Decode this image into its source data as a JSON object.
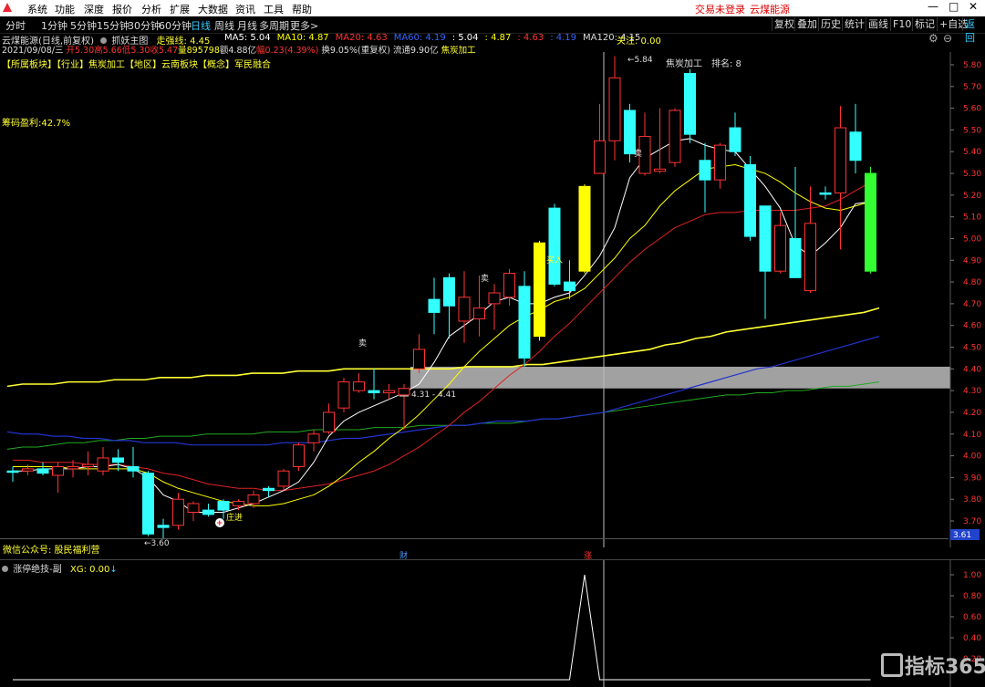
{
  "menubar": {
    "items": [
      "系统",
      "功能",
      "深度",
      "报价",
      "分析",
      "扩展",
      "大数据",
      "资讯",
      "工具",
      "帮助"
    ],
    "login_status": "交易未登录",
    "stock_name": "云煤能源"
  },
  "timeframes": {
    "items": [
      "分时",
      "1分钟",
      "5分钟",
      "15分钟",
      "30分钟",
      "60分钟",
      "日线",
      "周线",
      "月线",
      "多周期",
      "更多>"
    ],
    "active": "日线"
  },
  "right_buttons": [
    "复权",
    "叠加",
    "历史",
    "统计",
    "画线",
    "F10",
    "标记",
    "+自选",
    "返回"
  ],
  "chart_header": {
    "title": "云煤能源(日线,前复权)",
    "indicator_name": "抓妖主图",
    "trend_label": "走强线: 4.45",
    "ma_items": [
      {
        "text": "MA5: 5.04",
        "color": "#ffffff"
      },
      {
        "text": "MA10: 4.87",
        "color": "#ffff00"
      },
      {
        "text": "MA20: 4.63",
        "color": "#ff3333"
      },
      {
        "text": "MA60: 4.19",
        "color": "#3366ff"
      },
      {
        "text": ": 5.04",
        "color": "#ffffff"
      },
      {
        "text": ": 4.87",
        "color": "#ffff00"
      },
      {
        "text": ": 4.63",
        "color": "#ff3333"
      },
      {
        "text": ": 4.19",
        "color": "#3366ff"
      },
      {
        "text": "MA120: 4.15",
        "color": "#dddddd"
      }
    ],
    "watch": "关注: 0.00"
  },
  "info_line": {
    "date": "2021/09/08/三",
    "open": "开5.30",
    "high": "高5.66",
    "low": "低5.30",
    "close": "收5.47",
    "volume": "量895798",
    "amount": "额4.88亿",
    "change": "幅0.23(4.39%)",
    "turnover": "换9.05%(重复权)",
    "float": "流通9.90亿",
    "sector": "焦炭加工"
  },
  "sector_line": "【所属板块】【行业】焦炭加工【地区】云南板块【概念】军民融合",
  "chip_profit": "筹码盈利:42.7%",
  "annotations": {
    "peak": "5.84",
    "sector_tag": "焦炭加工",
    "rank": "排名: 8",
    "sell": "卖",
    "range": "4.31 - 4.41",
    "low": "3.60",
    "dealer": "庄进",
    "buy": "买入"
  },
  "price_axis": [
    "5.80",
    "5.70",
    "5.60",
    "5.50",
    "5.40",
    "5.30",
    "5.20",
    "5.10",
    "5.00",
    "4.90",
    "4.80",
    "4.70",
    "4.60",
    "4.50",
    "4.40",
    "4.30",
    "4.20",
    "4.10",
    "4.00",
    "3.90",
    "3.80",
    "3.70"
  ],
  "price_axis_current": "3.61",
  "bottom_bar": {
    "wechat": "微信公众号: 股民福利营",
    "cai": "财",
    "zhang": "涨"
  },
  "sub_chart": {
    "title": "涨停绝技-副",
    "xg": "XG: 0.00",
    "axis": [
      "1.00",
      "0.80",
      "0.60",
      "0.40",
      "0.20"
    ]
  },
  "watermark": "指标365",
  "colors": {
    "up": "#ff3333",
    "down": "#33ffff",
    "highlight_yellow": "#ffff00",
    "highlight_green": "#33ff33",
    "ma5": "#ffffff",
    "ma10": "#ffff00",
    "ma20": "#dd2222",
    "ma60": "#2233cc",
    "ma120": "#22aa22",
    "trend": "#ffff33"
  },
  "chart_data": {
    "type": "candlestick",
    "candles": [
      {
        "o": 3.93,
        "h": 3.95,
        "l": 3.88,
        "c": 3.93,
        "col": "down"
      },
      {
        "o": 3.93,
        "h": 3.96,
        "l": 3.91,
        "c": 3.94,
        "col": "up"
      },
      {
        "o": 3.94,
        "h": 3.97,
        "l": 3.91,
        "c": 3.92,
        "col": "down"
      },
      {
        "o": 3.91,
        "h": 3.97,
        "l": 3.83,
        "c": 3.95,
        "col": "up"
      },
      {
        "o": 3.95,
        "h": 3.98,
        "l": 3.9,
        "c": 3.94,
        "col": "up"
      },
      {
        "o": 3.95,
        "h": 4.02,
        "l": 3.91,
        "c": 3.96,
        "col": "up"
      },
      {
        "o": 3.93,
        "h": 4.04,
        "l": 3.91,
        "c": 3.99,
        "col": "up"
      },
      {
        "o": 3.99,
        "h": 4.03,
        "l": 3.93,
        "c": 3.97,
        "col": "down"
      },
      {
        "o": 3.95,
        "h": 4.04,
        "l": 3.9,
        "c": 3.93,
        "col": "down"
      },
      {
        "o": 3.92,
        "h": 3.93,
        "l": 3.63,
        "c": 3.64,
        "col": "down"
      },
      {
        "o": 3.68,
        "h": 3.71,
        "l": 3.62,
        "c": 3.67,
        "col": "down"
      },
      {
        "o": 3.68,
        "h": 3.83,
        "l": 3.66,
        "c": 3.8,
        "col": "up"
      },
      {
        "o": 3.74,
        "h": 3.79,
        "l": 3.7,
        "c": 3.78,
        "col": "up"
      },
      {
        "o": 3.75,
        "h": 3.78,
        "l": 3.72,
        "c": 3.73,
        "col": "down"
      },
      {
        "o": 3.75,
        "h": 3.8,
        "l": 3.71,
        "c": 3.79,
        "col": "down"
      },
      {
        "o": 3.77,
        "h": 3.8,
        "l": 3.75,
        "c": 3.79,
        "col": "up"
      },
      {
        "o": 3.78,
        "h": 3.84,
        "l": 3.76,
        "c": 3.82,
        "col": "up"
      },
      {
        "o": 3.84,
        "h": 3.86,
        "l": 3.81,
        "c": 3.85,
        "col": "down"
      },
      {
        "o": 3.86,
        "h": 3.94,
        "l": 3.84,
        "c": 3.93,
        "col": "up"
      },
      {
        "o": 3.95,
        "h": 4.06,
        "l": 3.93,
        "c": 4.05,
        "col": "up"
      },
      {
        "o": 4.06,
        "h": 4.12,
        "l": 4.02,
        "c": 4.1,
        "col": "up"
      },
      {
        "o": 4.11,
        "h": 4.24,
        "l": 4.1,
        "c": 4.2,
        "col": "up"
      },
      {
        "o": 4.22,
        "h": 4.36,
        "l": 4.2,
        "c": 4.34,
        "col": "up"
      },
      {
        "o": 4.34,
        "h": 4.38,
        "l": 4.29,
        "c": 4.3,
        "col": "up"
      },
      {
        "o": 4.3,
        "h": 4.4,
        "l": 4.26,
        "c": 4.29,
        "col": "down"
      },
      {
        "o": 4.29,
        "h": 4.33,
        "l": 4.26,
        "c": 4.3,
        "col": "up"
      },
      {
        "o": 4.31,
        "h": 4.33,
        "l": 4.12,
        "c": 4.28,
        "col": "up"
      },
      {
        "o": 4.4,
        "h": 4.56,
        "l": 4.38,
        "c": 4.49,
        "col": "up"
      },
      {
        "o": 4.72,
        "h": 4.82,
        "l": 4.56,
        "c": 4.66,
        "col": "down"
      },
      {
        "o": 4.69,
        "h": 4.84,
        "l": 4.54,
        "c": 4.82,
        "col": "down"
      },
      {
        "o": 4.62,
        "h": 4.85,
        "l": 4.52,
        "c": 4.73,
        "col": "up"
      },
      {
        "o": 4.63,
        "h": 4.83,
        "l": 4.55,
        "c": 4.68,
        "col": "up"
      },
      {
        "o": 4.7,
        "h": 4.79,
        "l": 4.58,
        "c": 4.75,
        "col": "up"
      },
      {
        "o": 4.73,
        "h": 4.86,
        "l": 4.69,
        "c": 4.84,
        "col": "up"
      },
      {
        "o": 4.78,
        "h": 4.85,
        "l": 4.41,
        "c": 4.45,
        "col": "down"
      },
      {
        "o": 4.55,
        "h": 4.99,
        "l": 4.53,
        "c": 4.98,
        "col": "yellow"
      },
      {
        "o": 4.79,
        "h": 5.16,
        "l": 4.78,
        "c": 5.14,
        "col": "down"
      },
      {
        "o": 4.76,
        "h": 4.9,
        "l": 4.72,
        "c": 4.8,
        "col": "down"
      },
      {
        "o": 4.85,
        "h": 5.25,
        "l": 4.84,
        "c": 5.24,
        "col": "yellow"
      },
      {
        "o": 5.45,
        "h": 5.62,
        "l": 5.3,
        "c": 5.3,
        "col": "up"
      },
      {
        "o": 5.45,
        "h": 5.84,
        "l": 5.36,
        "c": 5.74,
        "col": "up"
      },
      {
        "o": 5.59,
        "h": 5.62,
        "l": 5.35,
        "c": 5.39,
        "col": "down"
      },
      {
        "o": 5.3,
        "h": 5.58,
        "l": 5.29,
        "c": 5.47,
        "col": "up"
      },
      {
        "o": 5.32,
        "h": 5.6,
        "l": 5.3,
        "c": 5.31,
        "col": "up"
      },
      {
        "o": 5.35,
        "h": 5.6,
        "l": 5.33,
        "c": 5.59,
        "col": "up"
      },
      {
        "o": 5.76,
        "h": 5.78,
        "l": 5.44,
        "c": 5.48,
        "col": "down"
      },
      {
        "o": 5.36,
        "h": 5.44,
        "l": 5.12,
        "c": 5.27,
        "col": "down"
      },
      {
        "o": 5.27,
        "h": 5.44,
        "l": 5.23,
        "c": 5.43,
        "col": "up"
      },
      {
        "o": 5.51,
        "h": 5.58,
        "l": 5.38,
        "c": 5.4,
        "col": "down"
      },
      {
        "o": 5.34,
        "h": 5.38,
        "l": 4.99,
        "c": 5.01,
        "col": "down"
      },
      {
        "o": 5.15,
        "h": 5.15,
        "l": 4.63,
        "c": 4.85,
        "col": "down"
      },
      {
        "o": 5.06,
        "h": 5.12,
        "l": 4.84,
        "c": 4.85,
        "col": "up"
      },
      {
        "o": 5.0,
        "h": 5.33,
        "l": 4.82,
        "c": 4.82,
        "col": "down"
      },
      {
        "o": 5.07,
        "h": 5.24,
        "l": 4.75,
        "c": 4.76,
        "col": "up"
      },
      {
        "o": 5.21,
        "h": 5.24,
        "l": 5.18,
        "c": 5.21,
        "col": "down"
      },
      {
        "o": 5.51,
        "h": 5.61,
        "l": 4.95,
        "c": 5.21,
        "col": "up"
      },
      {
        "o": 5.49,
        "h": 5.62,
        "l": 5.3,
        "c": 5.36,
        "col": "down"
      },
      {
        "o": 5.3,
        "h": 5.33,
        "l": 4.84,
        "c": 4.85,
        "col": "green"
      }
    ],
    "ma5": [
      3.93,
      3.93,
      3.94,
      3.94,
      3.94,
      3.95,
      3.95,
      3.96,
      3.94,
      3.9,
      3.82,
      3.79,
      3.74,
      3.74,
      3.74,
      3.76,
      3.78,
      3.81,
      3.84,
      3.88,
      3.97,
      4.09,
      4.16,
      4.2,
      4.23,
      4.26,
      4.29,
      4.33,
      4.43,
      4.55,
      4.6,
      4.65,
      4.71,
      4.73,
      4.7,
      4.7,
      4.73,
      4.75,
      4.83,
      4.92,
      5.05,
      5.28,
      5.37,
      5.41,
      5.45,
      5.46,
      5.43,
      5.41,
      5.4,
      5.32,
      5.24,
      5.14,
      4.97,
      4.92,
      4.98,
      5.05,
      5.16,
      5.17
    ],
    "ma10": [
      3.95,
      3.95,
      3.95,
      3.95,
      3.94,
      3.94,
      3.94,
      3.94,
      3.94,
      3.92,
      3.88,
      3.85,
      3.83,
      3.81,
      3.79,
      3.78,
      3.77,
      3.77,
      3.78,
      3.8,
      3.82,
      3.86,
      3.91,
      3.97,
      4.02,
      4.08,
      4.13,
      4.19,
      4.26,
      4.33,
      4.41,
      4.48,
      4.54,
      4.6,
      4.64,
      4.67,
      4.71,
      4.73,
      4.77,
      4.84,
      4.91,
      5.0,
      5.06,
      5.15,
      5.22,
      5.27,
      5.32,
      5.33,
      5.34,
      5.32,
      5.3,
      5.26,
      5.21,
      5.17,
      5.14,
      5.13,
      5.15,
      5.17
    ],
    "ma20": [
      3.98,
      3.98,
      3.97,
      3.97,
      3.97,
      3.96,
      3.96,
      3.96,
      3.95,
      3.94,
      3.92,
      3.91,
      3.89,
      3.87,
      3.86,
      3.85,
      3.85,
      3.84,
      3.84,
      3.85,
      3.86,
      3.87,
      3.89,
      3.91,
      3.93,
      3.96,
      4.0,
      4.04,
      4.09,
      4.14,
      4.2,
      4.25,
      4.31,
      4.37,
      4.42,
      4.48,
      4.55,
      4.61,
      4.68,
      4.75,
      4.82,
      4.89,
      4.95,
      5.0,
      5.05,
      5.08,
      5.11,
      5.12,
      5.12,
      5.13,
      5.13,
      5.13,
      5.13,
      5.14,
      5.15,
      5.18,
      5.22,
      5.26
    ],
    "ma60": [
      4.11,
      4.1,
      4.1,
      4.09,
      4.09,
      4.08,
      4.08,
      4.07,
      4.07,
      4.06,
      4.06,
      4.06,
      4.05,
      4.05,
      4.05,
      4.05,
      4.05,
      4.05,
      4.06,
      4.06,
      4.06,
      4.07,
      4.08,
      4.08,
      4.09,
      4.1,
      4.11,
      4.12,
      4.13,
      4.14,
      4.14,
      4.15,
      4.16,
      4.16,
      4.16,
      4.17,
      4.17,
      4.18,
      4.19,
      4.2,
      4.22,
      4.24,
      4.26,
      4.28,
      4.3,
      4.32,
      4.34,
      4.36,
      4.38,
      4.4,
      4.41,
      4.43,
      4.45,
      4.47,
      4.49,
      4.51,
      4.53,
      4.55
    ],
    "ma120": [
      4.03,
      4.04,
      4.04,
      4.05,
      4.06,
      4.06,
      4.07,
      4.07,
      4.08,
      4.08,
      4.09,
      4.09,
      4.09,
      4.1,
      4.1,
      4.1,
      4.1,
      4.11,
      4.11,
      4.11,
      4.12,
      4.12,
      4.12,
      4.12,
      4.13,
      4.13,
      4.13,
      4.14,
      4.14,
      4.14,
      4.14,
      4.15,
      4.15,
      4.15,
      4.16,
      4.17,
      4.17,
      4.18,
      4.19,
      4.2,
      4.21,
      4.22,
      4.23,
      4.24,
      4.25,
      4.26,
      4.27,
      4.28,
      4.28,
      4.29,
      4.29,
      4.3,
      4.3,
      4.31,
      4.32,
      4.32,
      4.33,
      4.34
    ],
    "trend_line": [
      4.32,
      4.33,
      4.33,
      4.33,
      4.34,
      4.34,
      4.34,
      4.35,
      4.35,
      4.35,
      4.36,
      4.36,
      4.36,
      4.37,
      4.37,
      4.37,
      4.38,
      4.38,
      4.38,
      4.39,
      4.39,
      4.39,
      4.4,
      4.4,
      4.4,
      4.4,
      4.4,
      4.4,
      4.4,
      4.4,
      4.41,
      4.41,
      4.41,
      4.41,
      4.42,
      4.42,
      4.43,
      4.44,
      4.45,
      4.46,
      4.47,
      4.48,
      4.49,
      4.51,
      4.52,
      4.54,
      4.55,
      4.57,
      4.58,
      4.59,
      4.6,
      4.61,
      4.62,
      4.63,
      4.64,
      4.65,
      4.66,
      4.68
    ],
    "range_box": [
      4.31,
      4.41
    ],
    "xg": [
      0,
      0,
      0,
      0,
      0,
      0,
      0,
      0,
      0,
      0,
      0,
      0,
      0,
      0,
      0,
      0,
      0,
      0,
      0,
      0,
      0,
      0,
      0,
      0,
      0,
      0,
      0,
      0,
      0,
      0,
      0,
      0,
      0,
      0,
      0,
      0,
      0,
      0,
      1,
      0,
      0,
      0,
      0,
      0,
      0,
      0,
      0,
      0,
      0,
      0,
      0,
      0,
      0,
      0,
      0,
      0,
      0,
      0
    ]
  }
}
